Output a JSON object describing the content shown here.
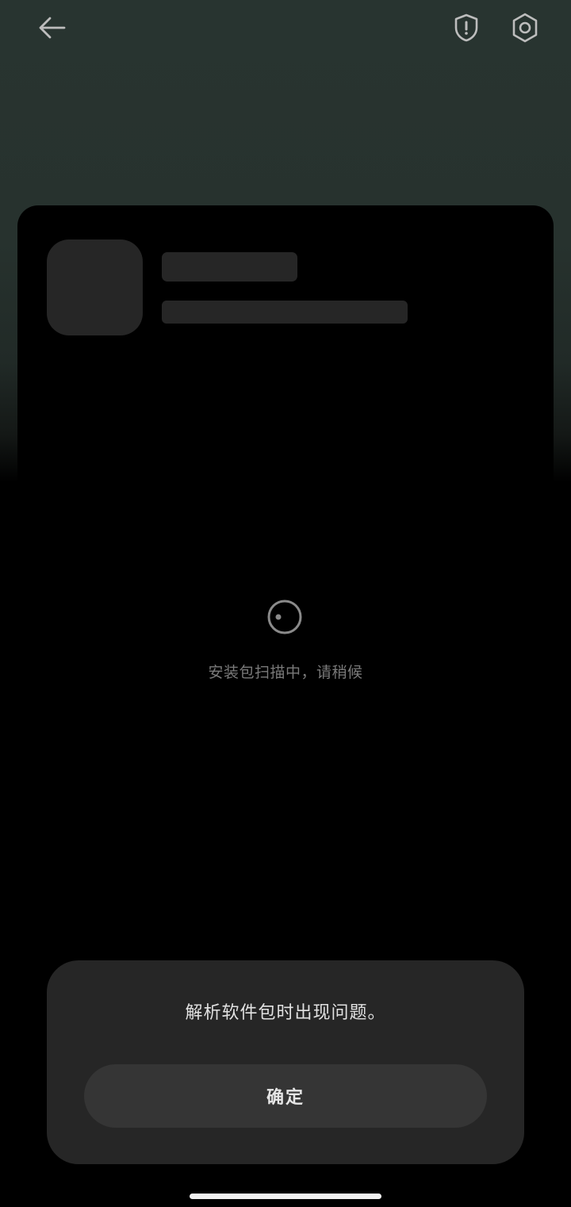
{
  "header": {
    "back_icon": "arrow-left-icon",
    "security_icon": "shield-exclamation-icon",
    "settings_icon": "hexagon-gear-icon"
  },
  "loading": {
    "message": "安装包扫描中，请稍候"
  },
  "dialog": {
    "message": "解析软件包时出现问题。",
    "confirm_label": "确定"
  },
  "colors": {
    "header_background": "#283430",
    "card_background": "#000000",
    "placeholder": "#262626",
    "dialog_background": "#262626",
    "button_background": "#353535",
    "muted_text": "#7a7a7a"
  }
}
